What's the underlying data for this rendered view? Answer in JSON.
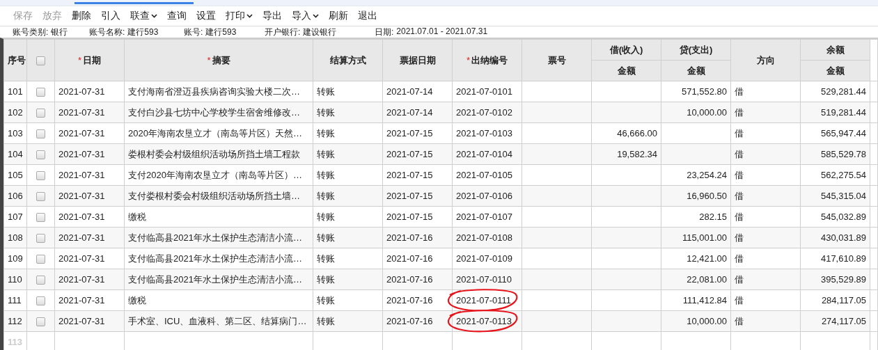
{
  "toolbar": [
    {
      "label": "保存",
      "disabled": true,
      "has_menu": false
    },
    {
      "label": "放弃",
      "disabled": true,
      "has_menu": false
    },
    {
      "label": "删除",
      "disabled": false,
      "has_menu": false
    },
    {
      "label": "引入",
      "disabled": false,
      "has_menu": false
    },
    {
      "label": "联查",
      "disabled": false,
      "has_menu": true
    },
    {
      "label": "查询",
      "disabled": false,
      "has_menu": false
    },
    {
      "label": "设置",
      "disabled": false,
      "has_menu": false
    },
    {
      "label": "打印",
      "disabled": false,
      "has_menu": true
    },
    {
      "label": "导出",
      "disabled": false,
      "has_menu": false
    },
    {
      "label": "导入",
      "disabled": false,
      "has_menu": true
    },
    {
      "label": "刷新",
      "disabled": false,
      "has_menu": false
    },
    {
      "label": "退出",
      "disabled": false,
      "has_menu": false
    }
  ],
  "info": [
    {
      "label": "账号类别:",
      "value": "银行"
    },
    {
      "label": "账号名称:",
      "value": "建行593"
    },
    {
      "label": "账号:",
      "value": "建行593"
    },
    {
      "label": "开户银行:",
      "value": "建设银行"
    },
    {
      "label": "日期:",
      "value": "2021.07.01 - 2021.07.31"
    }
  ],
  "table": {
    "columns": [
      {
        "label": "序号",
        "kind": "text"
      },
      {
        "kind": "check",
        "checked": false
      },
      {
        "label": "日期",
        "required_mark": "*",
        "kind": "text"
      },
      {
        "label": "摘要",
        "required_mark": "*",
        "kind": "text"
      },
      {
        "label": "结算方式",
        "kind": "text"
      },
      {
        "label": "票据日期",
        "kind": "text"
      },
      {
        "label": "出纳编号",
        "required_mark": "*",
        "kind": "text"
      },
      {
        "label": "票号",
        "kind": "text"
      },
      {
        "label": "借(收入)",
        "kind": "group",
        "sub": "金额"
      },
      {
        "label": "贷(支出)",
        "kind": "group",
        "sub": "金额"
      },
      {
        "label": "方向",
        "kind": "text"
      },
      {
        "label": "余额",
        "kind": "group",
        "sub": "金额"
      }
    ],
    "rows": [
      {
        "no": "101",
        "checked": false,
        "date": "2021-07-31",
        "summary": "支付海南省澄迈县疾病咨询实验大楼二次…",
        "method": "转账",
        "bill_date": "2021-07-14",
        "cashier_no": "2021-07-0101",
        "circled": false,
        "debit": "",
        "credit": "571,552.80",
        "direction": "借",
        "balance": "529,281.44"
      },
      {
        "no": "102",
        "checked": false,
        "date": "2021-07-31",
        "summary": "支付白沙县七坊中心学校学生宿舍维修改…",
        "method": "转账",
        "bill_date": "2021-07-14",
        "cashier_no": "2021-07-0102",
        "circled": false,
        "debit": "",
        "credit": "10,000.00",
        "direction": "借",
        "balance": "519,281.44"
      },
      {
        "no": "103",
        "checked": false,
        "date": "2021-07-31",
        "summary": "2020年海南农垦立才（南岛等片区）天然…",
        "method": "转账",
        "bill_date": "2021-07-15",
        "cashier_no": "2021-07-0103",
        "circled": false,
        "debit": "46,666.00",
        "credit": "",
        "direction": "借",
        "balance": "565,947.44"
      },
      {
        "no": "104",
        "checked": false,
        "date": "2021-07-31",
        "summary": "娄根村委会村级组织活动场所挡土墙工程款",
        "method": "转账",
        "bill_date": "2021-07-15",
        "cashier_no": "2021-07-0104",
        "circled": false,
        "debit": "19,582.34",
        "credit": "",
        "direction": "借",
        "balance": "585,529.78"
      },
      {
        "no": "105",
        "checked": false,
        "date": "2021-07-31",
        "summary": "支付2020年海南农垦立才（南岛等片区）…",
        "method": "转账",
        "bill_date": "2021-07-15",
        "cashier_no": "2021-07-0105",
        "circled": false,
        "debit": "",
        "credit": "23,254.24",
        "direction": "借",
        "balance": "562,275.54"
      },
      {
        "no": "106",
        "checked": false,
        "date": "2021-07-31",
        "summary": "支付娄根村委会村级组织活动场所挡土墙…",
        "method": "转账",
        "bill_date": "2021-07-15",
        "cashier_no": "2021-07-0106",
        "circled": false,
        "debit": "",
        "credit": "16,960.50",
        "direction": "借",
        "balance": "545,315.04"
      },
      {
        "no": "107",
        "checked": false,
        "date": "2021-07-31",
        "summary": "缴税",
        "method": "转账",
        "bill_date": "2021-07-15",
        "cashier_no": "2021-07-0107",
        "circled": false,
        "debit": "",
        "credit": "282.15",
        "direction": "借",
        "balance": "545,032.89"
      },
      {
        "no": "108",
        "checked": false,
        "date": "2021-07-31",
        "summary": "支付临高县2021年水土保护生态清洁小流…",
        "method": "转账",
        "bill_date": "2021-07-16",
        "cashier_no": "2021-07-0108",
        "circled": false,
        "debit": "",
        "credit": "115,001.00",
        "direction": "借",
        "balance": "430,031.89"
      },
      {
        "no": "109",
        "checked": false,
        "date": "2021-07-31",
        "summary": "支付临高县2021年水土保护生态清洁小流…",
        "method": "转账",
        "bill_date": "2021-07-16",
        "cashier_no": "2021-07-0109",
        "circled": false,
        "debit": "",
        "credit": "12,421.00",
        "direction": "借",
        "balance": "417,610.89"
      },
      {
        "no": "110",
        "checked": false,
        "date": "2021-07-31",
        "summary": "支付临高县2021年水土保护生态清洁小流…",
        "method": "转账",
        "bill_date": "2021-07-16",
        "cashier_no": "2021-07-0110",
        "circled": false,
        "debit": "",
        "credit": "22,081.00",
        "direction": "借",
        "balance": "395,529.89"
      },
      {
        "no": "111",
        "checked": false,
        "date": "2021-07-31",
        "summary": "缴税",
        "method": "转账",
        "bill_date": "2021-07-16",
        "cashier_no": "2021-07-0111",
        "circled": true,
        "debit": "",
        "credit": "111,412.84",
        "direction": "借",
        "balance": "284,117.05"
      },
      {
        "no": "112",
        "checked": false,
        "date": "2021-07-31",
        "summary": "手术室、ICU、血液科、第二区、结算病门…",
        "method": "转账",
        "bill_date": "2021-07-16",
        "cashier_no": "2021-07-0113",
        "circled": true,
        "debit": "",
        "credit": "10,000.00",
        "direction": "借",
        "balance": "274,117.05"
      }
    ],
    "new_row_no": "113"
  }
}
